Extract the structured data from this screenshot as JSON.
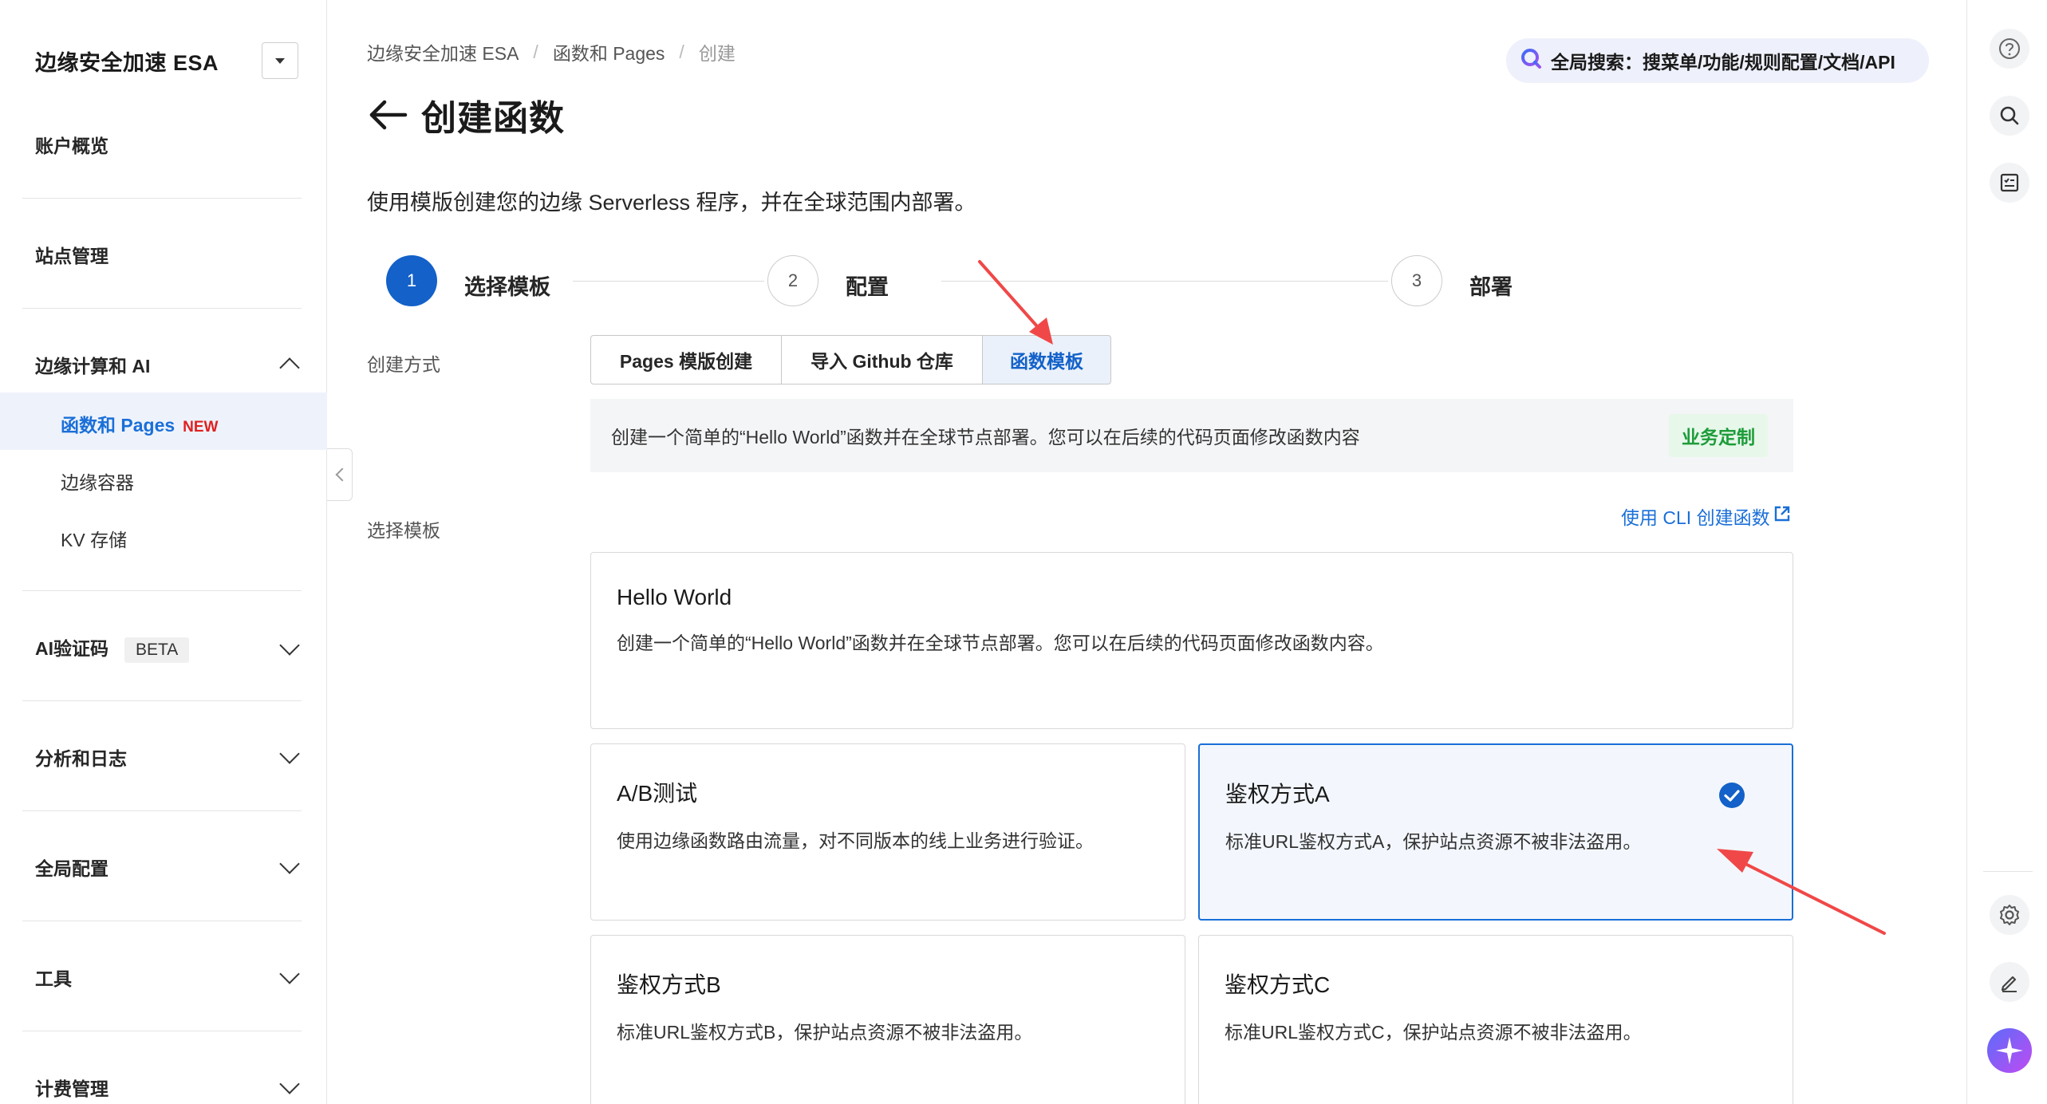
{
  "sidebar": {
    "title": "边缘安全加速 ESA",
    "overview": "账户概览",
    "site_mgmt": "站点管理",
    "edge_compute": "边缘计算和 AI",
    "sub_items": {
      "functions_pages": "函数和 Pages",
      "new_tag": "NEW",
      "edge_container": "边缘容器",
      "kv_storage": "KV 存储"
    },
    "ai_captcha": "AI验证码",
    "beta_tag": "BETA",
    "analytics": "分析和日志",
    "global_config": "全局配置",
    "tools": "工具",
    "billing": "计费管理"
  },
  "breadcrumb": [
    "边缘安全加速 ESA",
    "函数和 Pages",
    "创建"
  ],
  "global_search": "全局搜索：搜菜单/功能/规则配置/文档/API",
  "page_title": "创建函数",
  "page_desc": "使用模版创建您的边缘 Serverless 程序，并在全球范围内部署。",
  "steps": [
    {
      "num": "1",
      "label": "选择模板"
    },
    {
      "num": "2",
      "label": "配置"
    },
    {
      "num": "3",
      "label": "部署"
    }
  ],
  "create_method_label": "创建方式",
  "create_methods": [
    "Pages 模版创建",
    "导入 Github 仓库",
    "函数模板"
  ],
  "info_text": "创建一个简单的“Hello World”函数并在全球节点部署。您可以在后续的代码页面修改函数内容",
  "biz_tag": "业务定制",
  "select_template_label": "选择模板",
  "cli_link": "使用 CLI 创建函数",
  "templates": [
    {
      "title": "Hello World",
      "desc": "创建一个简单的“Hello World”函数并在全球节点部署。您可以在后续的代码页面修改函数内容。"
    },
    {
      "title": "A/B测试",
      "desc": "使用边缘函数路由流量，对不同版本的线上业务进行验证。"
    },
    {
      "title": "鉴权方式A",
      "desc": "标准URL鉴权方式A，保护站点资源不被非法盗用。"
    },
    {
      "title": "鉴权方式B",
      "desc": "标准URL鉴权方式B，保护站点资源不被非法盗用。"
    },
    {
      "title": "鉴权方式C",
      "desc": "标准URL鉴权方式C，保护站点资源不被非法盗用。"
    }
  ],
  "colors": {
    "primary": "#1361c9",
    "link": "#1a6fd8",
    "annotation_arrow": "#f04848",
    "biz_tag": "#1d9c3a"
  }
}
